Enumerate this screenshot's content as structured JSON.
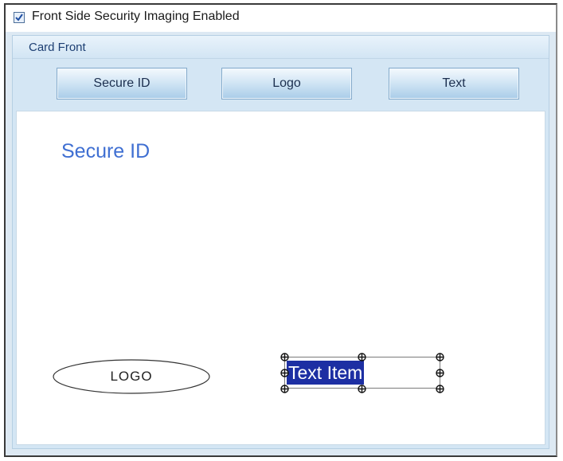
{
  "top": {
    "checkbox_checked": true,
    "checkbox_label": "Front Side Security Imaging Enabled"
  },
  "panel": {
    "title": "Card Front",
    "buttons": [
      {
        "label": "Secure ID"
      },
      {
        "label": "Logo"
      },
      {
        "label": "Text"
      }
    ]
  },
  "canvas": {
    "secure_id_text": "Secure ID",
    "logo_text": "LOGO",
    "text_item": "Text Item"
  },
  "colors": {
    "secure_id": "#3f6fd2",
    "selection": "#1d2fa3"
  }
}
